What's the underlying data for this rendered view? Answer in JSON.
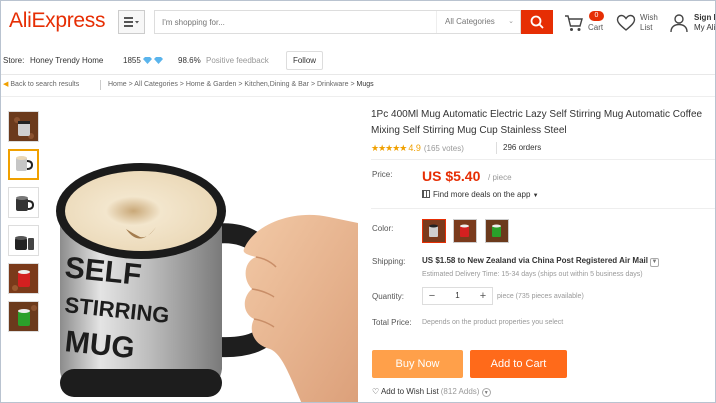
{
  "header": {
    "logo_text": "AliExpress",
    "search": {
      "placeholder": "I'm shopping for...",
      "category": "All Categories"
    },
    "cart": {
      "label": "Cart",
      "count": "0"
    },
    "wish": {
      "line1": "Wish",
      "line2": "List"
    },
    "account": {
      "line1": "Sign In",
      "line2": "My Ali"
    }
  },
  "store": {
    "prefix": "Store:",
    "name": "Honey Trendy Home",
    "score": "1855",
    "feedback_pct": "98.6%",
    "feedback_label": "Positive feedback",
    "follow_label": "Follow"
  },
  "breadcrumb": {
    "back_label": "Back to search results",
    "path": [
      "Home",
      "All Categories",
      "Home & Garden",
      "Kitchen,Dining & Bar",
      "Drinkware"
    ],
    "current": "Mugs"
  },
  "product": {
    "title": "1Pc 400Ml Mug Automatic Electric Lazy Self Stirring Mug Automatic Coffee Mixing Self Stirring Mug Cup Stainless Steel",
    "rating": "4.9",
    "rating_stars": 4.9,
    "votes": "(165 votes)",
    "orders": "296 orders",
    "price_label": "Price:",
    "price": "US $5.40",
    "per_unit": "/ piece",
    "app_deals": "Find more deals on the app",
    "color_label": "Color:",
    "shipping_label": "Shipping:",
    "shipping_main": "US $1.58 to New Zealand via China Post Registered Air Mail",
    "shipping_sub": "Estimated Delivery Time: 15-34 days (ships out within 5 business days)",
    "quantity_label": "Quantity:",
    "quantity_value": "1",
    "quantity_avail": "piece (735 pieces available)",
    "total_label": "Total Price:",
    "total_value": "Depends on the product properties you select",
    "buy_now": "Buy Now",
    "add_to_cart": "Add to Cart",
    "wishlist_label": "Add to Wish List",
    "wishlist_count": "(812 Adds)",
    "mug_text": [
      "SELF",
      "STIRRING",
      "MUG"
    ]
  },
  "colors": {
    "brand": "#e62e04",
    "star": "#f0a000",
    "buy_now_bg": "#ffa04a",
    "add_to_cart_bg": "#ff6a1a"
  },
  "icons": [
    "menu-icon",
    "search-icon",
    "cart-icon",
    "heart-icon",
    "user-icon",
    "diamond-icon",
    "back-arrow-icon",
    "qr-icon"
  ]
}
